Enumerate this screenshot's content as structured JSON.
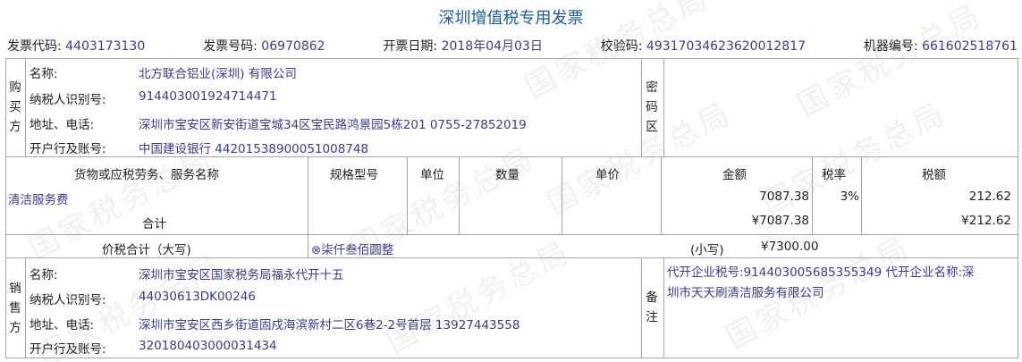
{
  "watermark": "国家税务总局",
  "title": "深圳增值税专用发票",
  "header": {
    "code_label": "发票代码:",
    "code": "4403173130",
    "number_label": "发票号码:",
    "number": "06970862",
    "date_label": "开票日期:",
    "date": "2018年04月03日",
    "check_label": "校验码:",
    "check": "49317034623620012817",
    "machine_label": "机器编号:",
    "machine": "661602518761"
  },
  "buyer": {
    "section_label": [
      "购",
      "买",
      "方"
    ],
    "name_label": "名称:",
    "name": "北方联合铝业(深圳) 有限公司",
    "tax_id_label": "纳税人识别号:",
    "tax_id": "914403001924714471",
    "address_label": "地址、电话:",
    "address": "深圳市宝安区新安街道宝城34区宝民路鸿景园5栋201 0755-27852019",
    "bank_label": "开户行及账号:",
    "bank": "中国建设银行 44201538900051008748"
  },
  "cipher_label": [
    "密",
    "码",
    "区"
  ],
  "items_table": {
    "headers": [
      "货物或应税劳务、服务名称",
      "规格型号",
      "单位",
      "数量",
      "单价",
      "金额",
      "税率",
      "税额"
    ],
    "rows": [
      {
        "name": "清洁服务费",
        "spec": "",
        "unit": "",
        "qty": "",
        "price": "",
        "amount": "7087.38",
        "rate": "3%",
        "tax": "212.62"
      }
    ],
    "total_label": "合计",
    "total_amount": "¥7087.38",
    "total_tax": "¥212.62"
  },
  "grand_total": {
    "label": "价税合计（大写)",
    "uppercase": "⊗柒仟叁佰圆整",
    "small_label": "(小写)",
    "small_value": "¥7300.00"
  },
  "seller": {
    "section_label": [
      "销",
      "售",
      "方"
    ],
    "name_label": "名称:",
    "name": "深圳市宝安区国家税务局福永代开十五",
    "tax_id_label": "纳税人识别号:",
    "tax_id": "44030613DK00246",
    "address_label": "地址、电话:",
    "address": "深圳市宝安区西乡街道固戍海滨新村二区6巷2-2号首层 13927443558",
    "bank_label": "开户行及账号:",
    "bank": "320180403000031434"
  },
  "remarks": {
    "label": [
      "备",
      "注"
    ],
    "line1": "代开企业税号:914403005685355349 代开企业名称:深",
    "line2": "圳市天天刷清洁服务有限公司"
  }
}
